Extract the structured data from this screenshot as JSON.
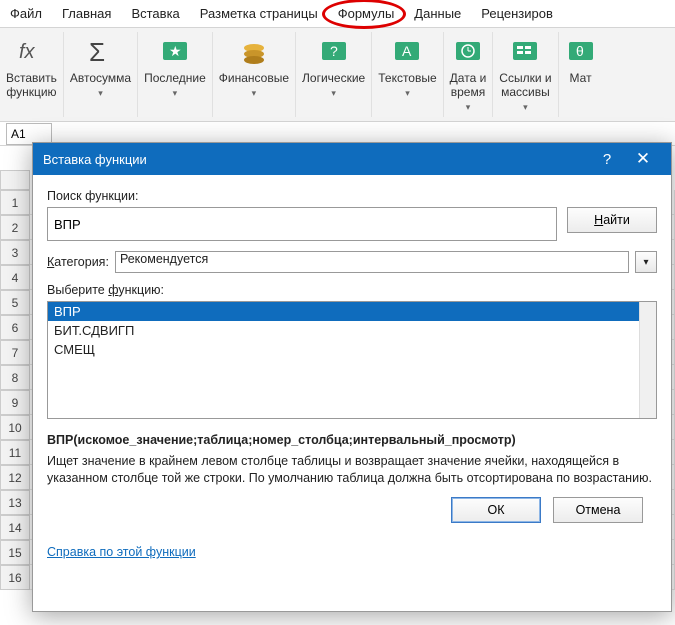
{
  "menu": {
    "items": [
      "Файл",
      "Главная",
      "Вставка",
      "Разметка страницы",
      "Формулы",
      "Данные",
      "Рецензиров"
    ],
    "active_index": 4
  },
  "ribbon": {
    "groups": [
      {
        "label": "Вставить\nфункцию",
        "drop": false
      },
      {
        "label": "Автосумма",
        "drop": true
      },
      {
        "label": "Последние",
        "drop": true
      },
      {
        "label": "Финансовые",
        "drop": true
      },
      {
        "label": "Логические",
        "drop": true
      },
      {
        "label": "Текстовые",
        "drop": true
      },
      {
        "label": "Дата и\nвремя",
        "drop": true
      },
      {
        "label": "Ссылки и\nмассивы",
        "drop": true
      },
      {
        "label": "Мат",
        "drop": false
      }
    ]
  },
  "namebox": "A1",
  "rows": [
    "1",
    "2",
    "3",
    "4",
    "5",
    "6",
    "7",
    "8",
    "9",
    "10",
    "11",
    "12",
    "13",
    "14",
    "15",
    "16"
  ],
  "dialog": {
    "title": "Вставка функции",
    "search_label": "Поиск функции:",
    "search_value": "ВПР",
    "find_label": "Найти",
    "category_label": "Категория:",
    "category_value": "Рекомендуется",
    "select_label": "Выберите функцию:",
    "functions": [
      "ВПР",
      "БИТ.СДВИГП",
      "СМЕЩ"
    ],
    "selected_index": 0,
    "syntax": "ВПР(искомое_значение;таблица;номер_столбца;интервальный_просмотр)",
    "description": "Ищет значение в крайнем левом столбце таблицы и возвращает значение ячейки, находящейся в указанном столбце той же строки. По умолчанию таблица должна быть отсортирована по возрастанию.",
    "help_link": "Справка по этой функции",
    "ok": "ОК",
    "cancel": "Отмена"
  }
}
